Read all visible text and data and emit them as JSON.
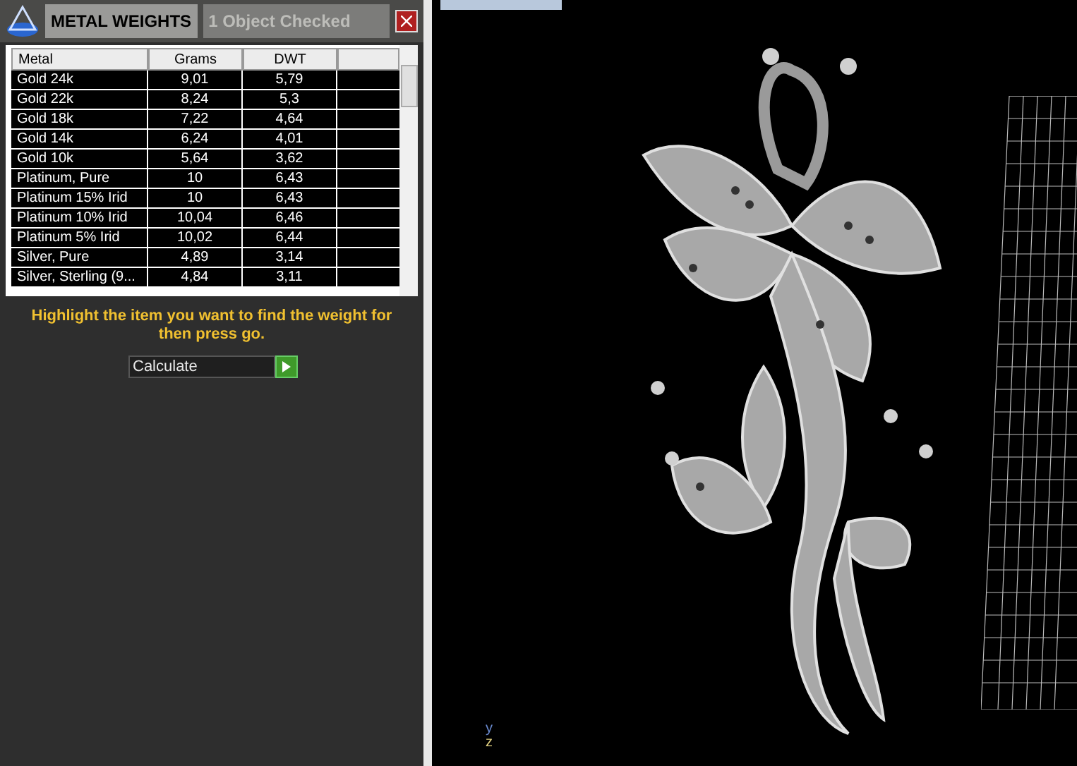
{
  "panel": {
    "title": "METAL WEIGHTS",
    "status": "1 Object Checked"
  },
  "table": {
    "columns": [
      "Metal",
      "Grams",
      "DWT"
    ],
    "rows": [
      {
        "metal": "Gold 24k",
        "grams": "9,01",
        "dwt": "5,79"
      },
      {
        "metal": "Gold 22k",
        "grams": "8,24",
        "dwt": "5,3"
      },
      {
        "metal": "Gold 18k",
        "grams": "7,22",
        "dwt": "4,64"
      },
      {
        "metal": "Gold 14k",
        "grams": "6,24",
        "dwt": "4,01"
      },
      {
        "metal": "Gold 10k",
        "grams": "5,64",
        "dwt": "3,62"
      },
      {
        "metal": "Platinum, Pure",
        "grams": "10",
        "dwt": "6,43"
      },
      {
        "metal": "Platinum 15% Irid",
        "grams": "10",
        "dwt": "6,43"
      },
      {
        "metal": "Platinum 10% Irid",
        "grams": "10,04",
        "dwt": "6,46"
      },
      {
        "metal": "Platinum 5% Irid",
        "grams": "10,02",
        "dwt": "6,44"
      },
      {
        "metal": "Silver, Pure",
        "grams": "4,89",
        "dwt": "3,14"
      },
      {
        "metal": "Silver, Sterling (9...",
        "grams": "4,84",
        "dwt": "3,11"
      }
    ]
  },
  "instruction": "Highlight the item you want to find the weight for then press go.",
  "action": {
    "value": "Calculate"
  },
  "viewport": {
    "axes": [
      "y",
      "z"
    ]
  }
}
